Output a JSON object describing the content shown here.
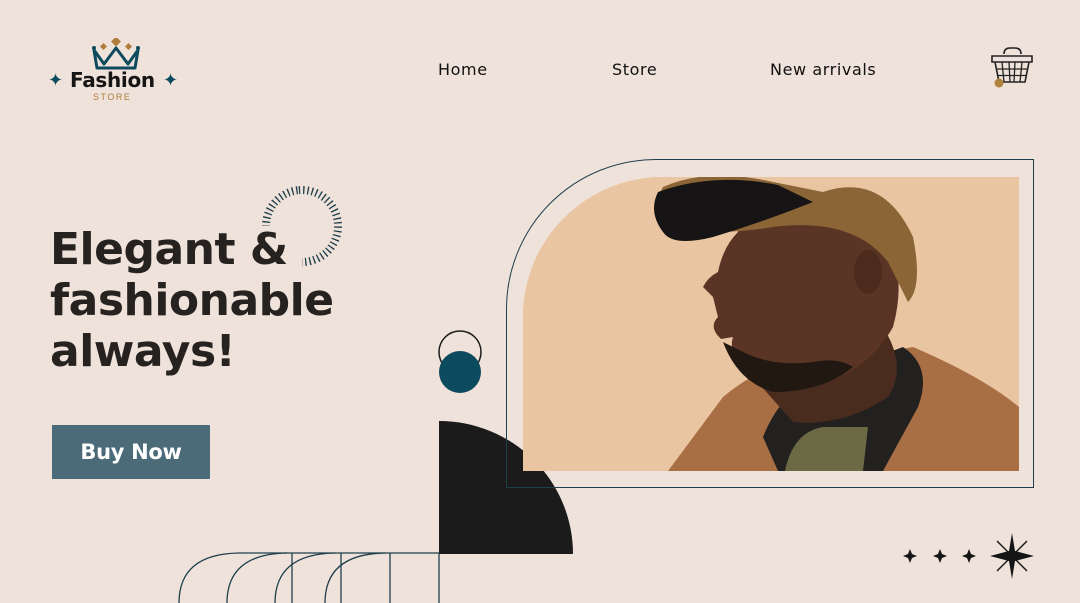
{
  "brand": {
    "name": "Fashion",
    "tagline": "STORE",
    "icons": [
      "crown-icon",
      "sparkle-icon"
    ],
    "colors": {
      "primary": "#0d4a5e",
      "gold": "#b07d3d"
    }
  },
  "nav": {
    "items": [
      {
        "label": "Home"
      },
      {
        "label": "Store"
      },
      {
        "label": "New arrivals"
      }
    ],
    "cart_icon": "shopping-basket-icon"
  },
  "hero": {
    "headline": [
      "Elegant &",
      "fashionable",
      "always!"
    ],
    "cta_label": "Buy Now",
    "cta_color": "#4c6b78",
    "background": "#efe2da",
    "photo_alt": "Man wearing a brown cap and suede jacket looking to the side"
  }
}
